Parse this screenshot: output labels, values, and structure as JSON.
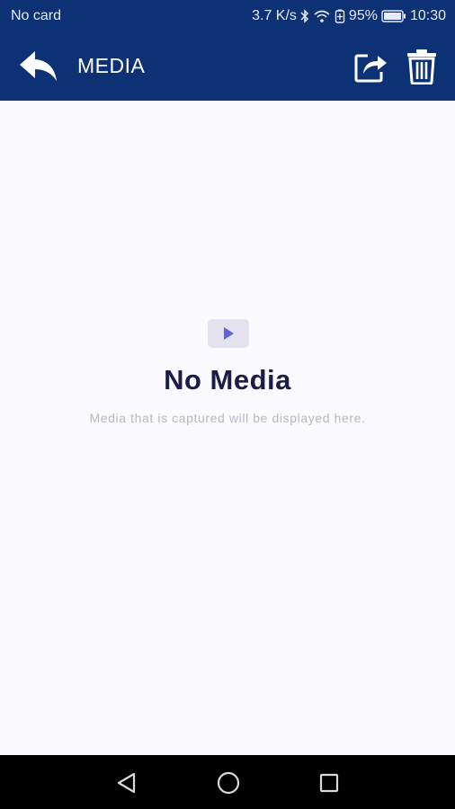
{
  "status_bar": {
    "carrier": "No card",
    "net_speed": "3.7 K/s",
    "battery_percent": "95%",
    "time": "10:30",
    "icons": [
      "bluetooth-icon",
      "wifi-icon",
      "battery-saver-icon",
      "battery-icon"
    ]
  },
  "app_bar": {
    "title": "MEDIA",
    "icons": [
      "back-arrow-icon",
      "share-icon",
      "trash-icon"
    ]
  },
  "empty_state": {
    "icon": "play-icon",
    "title": "No Media",
    "subtitle": "Media that is captured will be displayed here."
  },
  "nav_bar": {
    "icons": [
      "nav-back-icon",
      "nav-home-icon",
      "nav-recents-icon"
    ]
  },
  "colors": {
    "primary": "#0c3275",
    "background": "#fbfaff",
    "title_text": "#1c1d46",
    "subtitle_text": "#b6b6c3",
    "play_accent": "#5f64dc"
  }
}
